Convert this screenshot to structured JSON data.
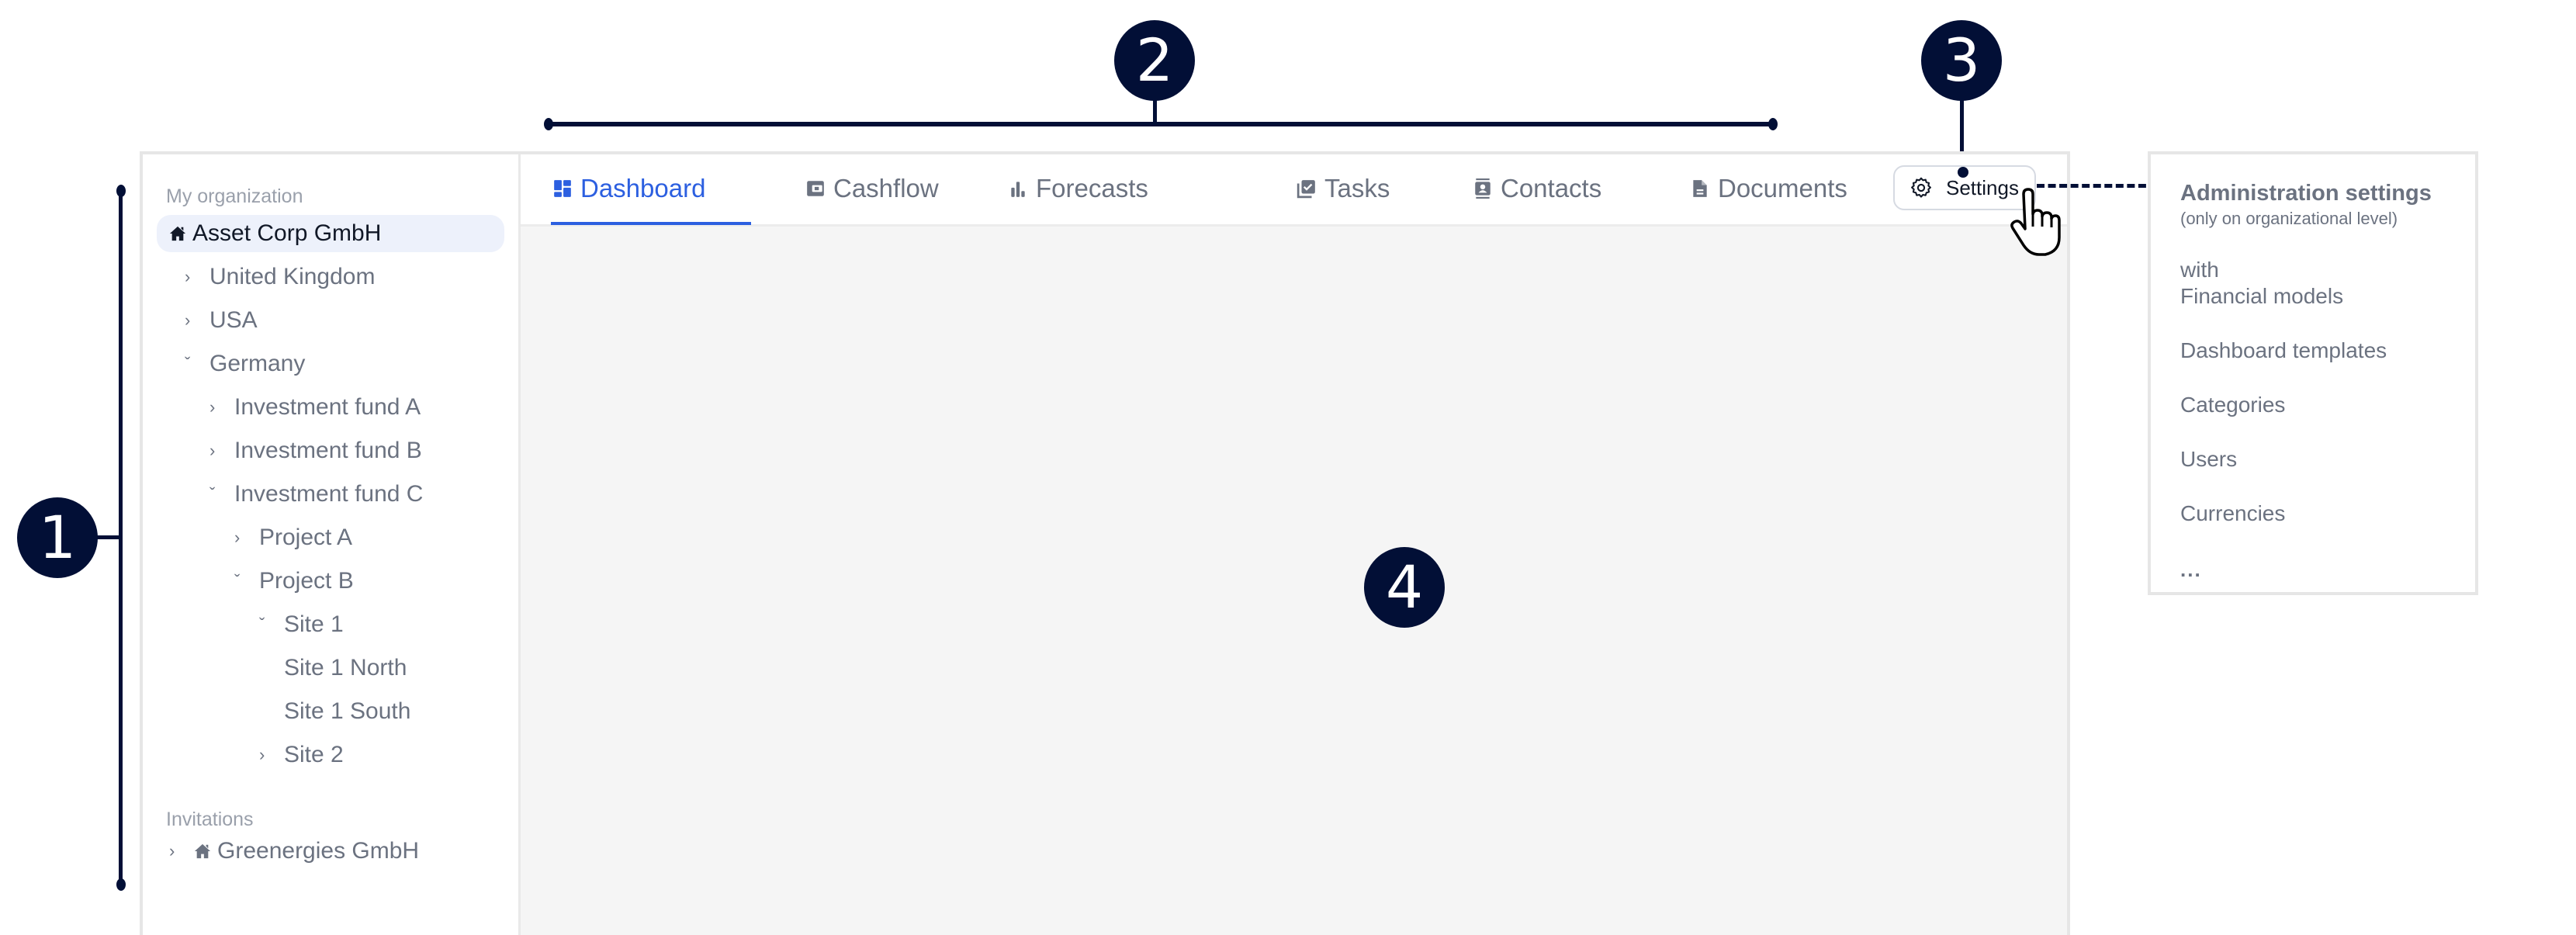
{
  "callouts": {
    "one": "1",
    "two": "2",
    "three": "3",
    "four": "4"
  },
  "sidebar": {
    "my_org_label": "My organization",
    "tree": [
      {
        "label": "Asset Corp GmbH",
        "icon": "home-icon",
        "selected": true
      },
      {
        "label": "United Kingdom",
        "chevron": "right"
      },
      {
        "label": "USA",
        "chevron": "right"
      },
      {
        "label": "Germany",
        "chevron": "down"
      },
      {
        "label": "Investment fund A",
        "chevron": "right"
      },
      {
        "label": "Investment fund B",
        "chevron": "right"
      },
      {
        "label": "Investment fund C",
        "chevron": "down"
      },
      {
        "label": "Project A",
        "chevron": "right"
      },
      {
        "label": "Project B",
        "chevron": "down"
      },
      {
        "label": "Site 1",
        "chevron": "down"
      },
      {
        "label": "Site 1 North"
      },
      {
        "label": "Site 1 South"
      },
      {
        "label": "Site 2",
        "chevron": "right"
      }
    ],
    "invitations_label": "Invitations",
    "invitations": [
      {
        "label": "Greenergies GmbH",
        "icon": "home-icon",
        "chevron": "right"
      }
    ]
  },
  "tabs": [
    {
      "label": "Dashboard",
      "icon": "dashboard-icon",
      "active": true
    },
    {
      "label": "Cashflow",
      "icon": "wallet-icon"
    },
    {
      "label": "Forecasts",
      "icon": "bar-chart-icon"
    },
    {
      "label": "Tasks",
      "icon": "tasks-icon"
    },
    {
      "label": "Contacts",
      "icon": "contacts-icon"
    },
    {
      "label": "Documents",
      "icon": "document-icon"
    }
  ],
  "settings_button": {
    "label": "Settings",
    "icon": "gear-icon"
  },
  "admin_panel": {
    "title": "Administration settings",
    "subtitle": "(only on organizational level)",
    "items": [
      {
        "label_line1": "with",
        "label_line2": "Financial models"
      },
      {
        "label": "Dashboard templates"
      },
      {
        "label": "Categories"
      },
      {
        "label": "Users"
      },
      {
        "label": "Currencies"
      }
    ],
    "more": "..."
  },
  "colors": {
    "accent": "#2c5fe0",
    "callout": "#020f36",
    "muted_text": "#6b7280",
    "selected_bg": "#edf1fb",
    "content_bg": "#f5f5f5"
  }
}
